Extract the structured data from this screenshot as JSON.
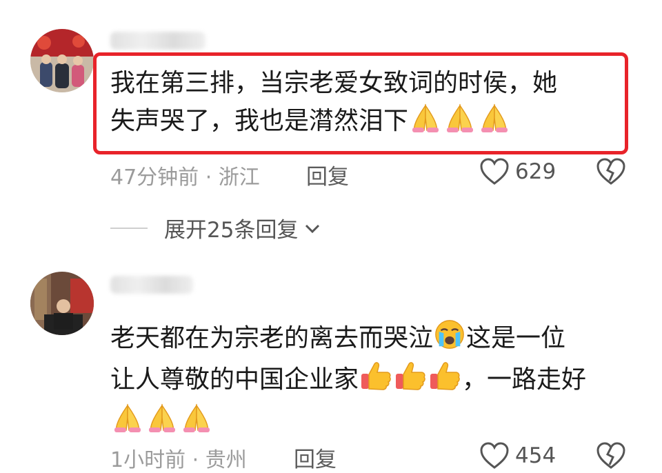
{
  "comments": [
    {
      "text_lines": [
        "我在第三排，当宗老爱女致词的时侯，她",
        "失声哭了，我也是潸然泪下"
      ],
      "emojis": [
        "folded-hands",
        "folded-hands",
        "folded-hands"
      ],
      "time_location": "47分钟前 · 浙江",
      "reply_label": "回复",
      "likes": "629"
    },
    {
      "text_lines": [
        "老天都在为宗老的离去而哭泣",
        "这是一位",
        "让人尊敬的中国企业家",
        "，一路走好"
      ],
      "emojis_line1": [
        "loudly-crying-face"
      ],
      "emojis_line2": [
        "thumbs-up",
        "thumbs-up",
        "thumbs-up"
      ],
      "emojis_line3": [
        "folded-hands",
        "folded-hands",
        "folded-hands"
      ],
      "time_location": "1小时前 · 贵州",
      "reply_label": "回复",
      "likes": "454"
    }
  ],
  "expand_replies_label": "展开25条回复",
  "colors": {
    "highlight": "#e8232a",
    "meta": "#9b9b9b"
  },
  "icons": [
    "heart-icon",
    "broken-heart-icon",
    "chevron-down-icon",
    "folded-hands-emoji",
    "thumbs-up-emoji",
    "crying-face-emoji"
  ]
}
